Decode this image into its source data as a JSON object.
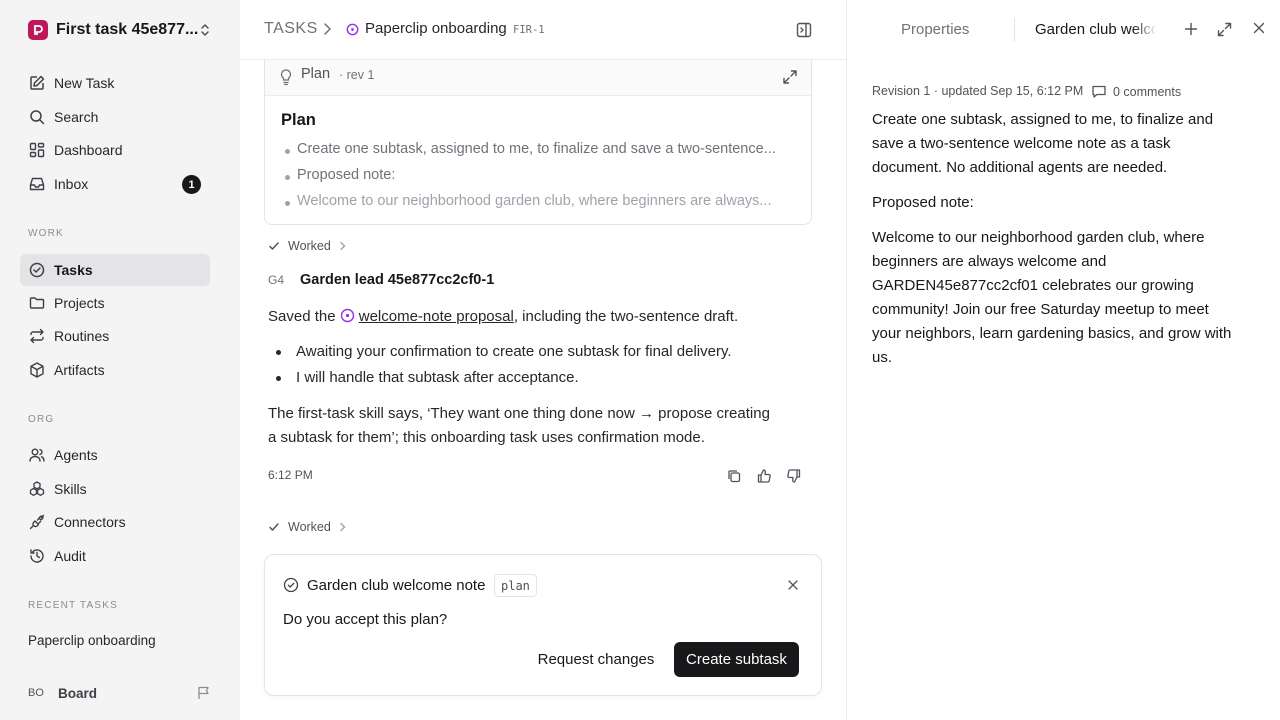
{
  "workspace": {
    "name": "First task 45e877...",
    "logo_letter": "P"
  },
  "nav": {
    "new_task": "New Task",
    "search": "Search",
    "dashboard": "Dashboard",
    "inbox": "Inbox",
    "inbox_count": "1"
  },
  "sections": {
    "work": "WORK",
    "org": "ORG",
    "recent": "RECENT TASKS"
  },
  "work_items": {
    "tasks": "Tasks",
    "projects": "Projects",
    "routines": "Routines",
    "artifacts": "Artifacts"
  },
  "org_items": {
    "agents": "Agents",
    "skills": "Skills",
    "connectors": "Connectors",
    "audit": "Audit"
  },
  "recent_tasks": [
    "Paperclip onboarding"
  ],
  "board": {
    "initials": "BO",
    "name": "Board"
  },
  "breadcrumb": {
    "root": "TASKS",
    "title": "Paperclip onboarding",
    "id": "FIR-1"
  },
  "plan_card": {
    "label": "Plan",
    "revision": "· rev 1",
    "title": "Plan",
    "items": [
      "Create one subtask, assigned to me, to finalize and save a two-sentence...",
      "Proposed note:",
      "Welcome to our neighborhood garden club, where beginners are always..."
    ]
  },
  "worked_label": "Worked",
  "message": {
    "avatar": "G4",
    "author": "Garden lead 45e877cc2cf0-1",
    "intro_before": "Saved the",
    "link_text": "welcome-note proposal",
    "intro_after": ", including the two-sentence draft.",
    "bullets": [
      "Awaiting your confirmation to create one subtask for final delivery.",
      "I will handle that subtask after acceptance."
    ],
    "line1": "The first-task skill says, ‘They want one thing done now → propose creating",
    "line2": "a subtask for them’; this onboarding task uses confirmation mode.",
    "time": "6:12 PM"
  },
  "confirm": {
    "title": "Garden club welcome note",
    "tag": "plan",
    "question": "Do you accept this plan?",
    "request_changes": "Request changes",
    "create_subtask": "Create subtask"
  },
  "right_panel": {
    "tab_properties": "Properties",
    "tab_document": "Garden club welcome note",
    "meta": "Revision 1 · updated Sep 15, 6:12 PM",
    "comments": "0 comments",
    "p1_l1": "Create one subtask, assigned to me, to finalize and",
    "p1_l2": "save a two-sentence welcome note as a task",
    "p1_l3": "document. No additional agents are needed.",
    "p2": "Proposed note:",
    "p3_l1": "Welcome to our neighborhood garden club, where",
    "p3_l2": "beginners are always welcome and",
    "p3_l3": "GARDEN45e877cc2cf01 celebrates our growing",
    "p3_l4": "community! Join our free Saturday meetup to meet",
    "p3_l5": "your neighbors, learn gardening basics, and grow with",
    "p3_l6": "us."
  },
  "colors": {
    "accent_purple": "#9333ea",
    "logo_pink": "#be185d",
    "primary_button": "#18181b"
  }
}
